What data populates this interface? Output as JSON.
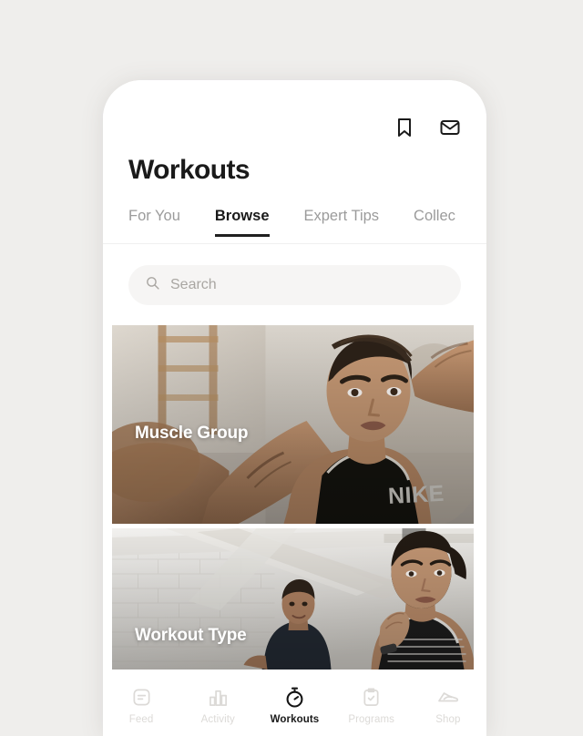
{
  "theme": {
    "page_background": "#efeeec",
    "screen_background": "#ffffff",
    "accent": "#1a1a1a",
    "muted_text": "#9b9b9b",
    "nav_inactive": "#dcdad7",
    "search_background": "#f6f5f4"
  },
  "header": {
    "title": "Workouts",
    "actions": [
      {
        "name": "bookmark-icon",
        "label": "Bookmark"
      },
      {
        "name": "mail-icon",
        "label": "Inbox"
      }
    ]
  },
  "tabs": [
    {
      "label": "For You",
      "active": false
    },
    {
      "label": "Browse",
      "active": true
    },
    {
      "label": "Expert Tips",
      "active": false
    },
    {
      "label": "Collec",
      "active": false
    }
  ],
  "search": {
    "placeholder": "Search",
    "value": "",
    "icon": "search-icon"
  },
  "cards": [
    {
      "label": "Muscle Group",
      "description": "Woman in black NIKE tank top flexing with arms raised behind head in a gym"
    },
    {
      "label": "Workout Type",
      "description": "Man and woman training in a bright white brick loft studio"
    }
  ],
  "bottom_nav": [
    {
      "label": "Feed",
      "icon": "feed-icon",
      "active": false
    },
    {
      "label": "Activity",
      "icon": "activity-icon",
      "active": false
    },
    {
      "label": "Workouts",
      "icon": "stopwatch-icon",
      "active": true
    },
    {
      "label": "Programs",
      "icon": "clipboard-icon",
      "active": false
    },
    {
      "label": "Shop",
      "icon": "shoe-icon",
      "active": false
    }
  ]
}
